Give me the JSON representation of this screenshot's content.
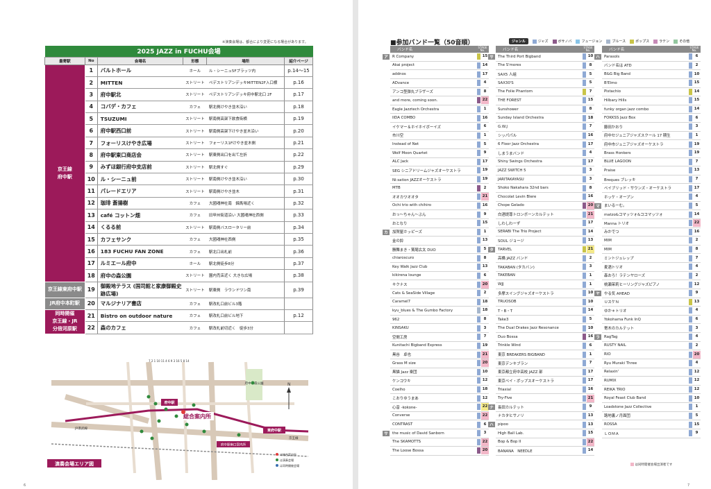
{
  "left_page": {
    "note": "※演奏会場は、都合により変更になる場合があります。",
    "title": "2025 JAZZ in FUCHU会場",
    "headers": [
      "最寄駅",
      "No",
      "会場名",
      "形態",
      "場所",
      "紹介ページ"
    ],
    "stations": [
      {
        "label": "京王線\n府中駅",
        "rows": 18
      },
      {
        "label": "京王線東府中駅",
        "rows": 1
      },
      {
        "label": "JR府中本町駅",
        "rows": 1
      },
      {
        "label": "同時開催\n京王線・JR\n分倍河原駅",
        "rows": 3
      }
    ],
    "venues": [
      {
        "no": "1",
        "name": "バルトホール",
        "form": "ホール",
        "place": "ル・シーニュ5Fプラッツ内",
        "page": "p.14～15"
      },
      {
        "no": "2",
        "name": "MITTEN",
        "form": "ストリート",
        "place": "ペデストリアンデッキMITTEN2F入口横",
        "page": "p.16"
      },
      {
        "no": "3",
        "name": "府中駅北",
        "form": "ストリート",
        "place": "ペデストリアンデッキ府中駅北口 2F",
        "page": "p.17"
      },
      {
        "no": "4",
        "name": "コバデ・カフェ",
        "form": "カフェ",
        "place": "駅北側けやき並木沿い",
        "page": "p.18"
      },
      {
        "no": "5",
        "name": "TSUZUMI",
        "form": "ストリート",
        "place": "駅南側高架下飲食街横",
        "page": "p.19"
      },
      {
        "no": "6",
        "name": "府中駅西口前",
        "form": "ストリート",
        "place": "駅南側高架下けやき並木沿い",
        "page": "p.20"
      },
      {
        "no": "7",
        "name": "フォーリスけやき広場",
        "form": "ストリート",
        "place": "フォーリス1Fけやき並木側",
        "page": "p.21"
      },
      {
        "no": "8",
        "name": "府中駅東口商店会",
        "form": "ストリート",
        "place": "駅東側出口を出て左折",
        "page": "p.22"
      },
      {
        "no": "9",
        "name": "みずほ銀行府中支店前",
        "form": "ストリート",
        "place": "駅北側すぐ",
        "page": "p.29"
      },
      {
        "no": "10",
        "name": "ル・シーニュ前",
        "form": "ストリート",
        "place": "駅南側けやき並木沿い",
        "page": "p.30"
      },
      {
        "no": "11",
        "name": "パレードエリア",
        "form": "ストリート",
        "place": "駅南側けやき並木",
        "page": "p.31"
      },
      {
        "no": "12",
        "name": "珈琲 蒼揚樹",
        "form": "カフェ",
        "place": "大國魂神社南　錦馬場近く",
        "page": "p.32"
      },
      {
        "no": "13",
        "name": "café コットン畑",
        "form": "カフェ",
        "place": "旧甲州街道沿い 大國魂神社西側",
        "page": "p.33"
      },
      {
        "no": "14",
        "name": "くるる前",
        "form": "ストリート",
        "place": "駅南側バスロータリー前",
        "page": "p.34"
      },
      {
        "no": "15",
        "name": "カフェサンク",
        "form": "カフェ",
        "place": "大國魂神社西側",
        "page": "p.35"
      },
      {
        "no": "16",
        "name": "183 FUCHU FAN ZONE",
        "form": "カフェ",
        "place": "駅北口出札前",
        "page": "p.36"
      },
      {
        "no": "17",
        "name": "ルミエール府中",
        "form": "ホール",
        "place": "駅北側徒歩8分",
        "page": "p.37"
      },
      {
        "no": "18",
        "name": "府中の森公園",
        "form": "ストリート",
        "place": "園内売店近く 大きな広場",
        "page": "p.38"
      },
      {
        "no": "19",
        "name": "御殿地テラス (国司館と家康御殿史跡広場)",
        "form": "ストリート",
        "place": "駅東側　ラウンドワン南",
        "page": "p.39"
      },
      {
        "no": "20",
        "name": "マルジナリア書店",
        "form": "カフェ",
        "place": "駅改札口前ビル3階",
        "page": ""
      },
      {
        "no": "21",
        "name": "Bistro on outdoor nature",
        "form": "カフェ",
        "place": "駅改札口前ビル地下",
        "page": "p.12"
      },
      {
        "no": "22",
        "name": "森のカフェ",
        "form": "カフェ",
        "place": "駅改札前切近く　徒歩3分",
        "page": ""
      }
    ],
    "map": {
      "title": "演奏会場エリア図",
      "info_center": "総合案内所",
      "fuchu_station": "府中駅",
      "higashi_station": "東府中駅",
      "keio_line": "京王線",
      "jr_line": "JR南武線",
      "sub_center": "府中駅南口案内所",
      "park": "府中の森公園",
      "legend": [
        "は総合案内所",
        "は演奏会場",
        "は同時開催会場"
      ],
      "north": "N"
    },
    "page_number": "6"
  },
  "right_page": {
    "title": "■参加バンド一覧（50音順）",
    "legend_label": "ジャンル",
    "genres": [
      {
        "name": "ジャズ",
        "color": "#8fa9d4"
      },
      {
        "name": "ボサノバ",
        "color": "#8c5a8a"
      },
      {
        "name": "フュージョン",
        "color": "#88c4e8"
      },
      {
        "name": "ブルース",
        "color": "#a7b7cc"
      },
      {
        "name": "ポップス",
        "color": "#c9c448"
      },
      {
        "name": "ラテン",
        "color": "#c78bb8"
      },
      {
        "name": "その他",
        "color": "#94c7a0"
      }
    ],
    "col_header": {
      "name": "バンド名",
      "stage": "STAGE No."
    },
    "columns": [
      [
        {
          "kana": "ア",
          "name": "R Company",
          "g": "#c9c448",
          "no": "15"
        },
        {
          "name": "Akai project",
          "g": "#8fa9d4",
          "no": "14"
        },
        {
          "name": "addnos",
          "g": "#8fa9d4",
          "no": "17"
        },
        {
          "name": "ADvance",
          "g": "#8fa9d4",
          "no": "4"
        },
        {
          "name": "アンコ型弾丸ブラザーズ",
          "g": "#8fa9d4",
          "no": "8"
        },
        {
          "name": "and more, coming soon.",
          "g": "#8c5a8a",
          "no": "22",
          "hl": "pink"
        },
        {
          "name": "Eagle Jazztech Orchestra",
          "g": "#8fa9d4",
          "no": "1"
        },
        {
          "name": "IIDA COMBO",
          "g": "#8fa9d4",
          "no": "16"
        },
        {
          "name": "イケマー＆ホイホイボーイズ",
          "g": "#8fa9d4",
          "no": "6"
        },
        {
          "name": "市川空",
          "g": "#8fa9d4",
          "no": "1"
        },
        {
          "name": "Instead of Net",
          "g": "#8fa9d4",
          "no": "5"
        },
        {
          "name": "Wolf Moon Quartet",
          "g": "#8fa9d4",
          "no": "9"
        },
        {
          "name": "ALC Jack",
          "g": "#8fa9d4",
          "no": "17"
        },
        {
          "name": "SEG シニアドリームジャズオーケストラ",
          "g": "#8fa9d4",
          "no": "19"
        },
        {
          "name": "Ni:sation JAZZオーケストラ",
          "g": "#8fa9d4",
          "no": "19"
        },
        {
          "name": "MTB",
          "g": "#8c5a8a",
          "no": "2"
        },
        {
          "name": "オオカワオオタ",
          "g": "#8fa9d4",
          "no": "21",
          "hl": "pink"
        },
        {
          "name": "Ochi trio with chihiro",
          "g": "#8fa9d4",
          "no": "16"
        },
        {
          "name": "おっ～ちゃん～ぶん",
          "g": "#8fa9d4",
          "no": "9"
        },
        {
          "name": "おとなり",
          "g": "#8fa9d4",
          "no": "15"
        },
        {
          "kana": "カ",
          "name": "加賀屋ホッピーズ",
          "g": "#8fa9d4",
          "no": "1"
        },
        {
          "name": "金の鈴",
          "g": "#8fa9d4",
          "no": "13"
        },
        {
          "name": "勝舞まき・鷲尾広太 DUO",
          "g": "#8fa9d4",
          "no": "5"
        },
        {
          "name": "chiaroscuro",
          "g": "#8fa9d4",
          "no": "8"
        },
        {
          "name": "Key Walk Jazz Club",
          "g": "#8fa9d4",
          "no": "13"
        },
        {
          "name": "kikirena lounge",
          "g": "#8fa9d4",
          "no": "6"
        },
        {
          "name": "キクナス",
          "g": "#8fa9d4",
          "no": "20",
          "hl": "pink"
        },
        {
          "name": "Cats & SeaSide Village",
          "g": "#8fa9d4",
          "no": "2"
        },
        {
          "name": "Caramel7",
          "g": "#8fa9d4",
          "no": "18"
        },
        {
          "name": "kyu_blues & The Gumbo Factory",
          "g": "#a7b7cc",
          "no": "18"
        },
        {
          "name": "962",
          "g": "#8fa9d4",
          "no": "8"
        },
        {
          "name": "KINSAKU",
          "g": "#8fa9d4",
          "no": "3"
        },
        {
          "name": "空間工房",
          "g": "#8fa9d4",
          "no": "7"
        },
        {
          "name": "Kunitachi Bigband Express",
          "g": "#8fa9d4",
          "no": "19"
        },
        {
          "name": "黒谷　卓也",
          "g": "#8fa9d4",
          "no": "21",
          "hl": "pink"
        },
        {
          "name": "Grass M size",
          "g": "#8fa9d4",
          "no": "20",
          "hl": "pink"
        },
        {
          "name": "黒猫 Jazz 楽団",
          "g": "#8fa9d4",
          "no": "10"
        },
        {
          "name": "ケンコウキ",
          "g": "#8fa9d4",
          "no": "12"
        },
        {
          "name": "Coelho",
          "g": "#8fa9d4",
          "no": "18"
        },
        {
          "name": "こおりゆうまあ",
          "g": "#8fa9d4",
          "no": "12"
        },
        {
          "name": "心音 -kokone-",
          "g": "#8fa9d4",
          "no": "22",
          "hl": "yel"
        },
        {
          "name": "Converse",
          "g": "#8fa9d4",
          "no": "22",
          "hl": "pink"
        },
        {
          "name": "CONTRAST",
          "g": "#8fa9d4",
          "no": "6"
        },
        {
          "kana": "サ",
          "name": "the music of David Sanborn",
          "g": "#8fa9d4",
          "no": "3"
        },
        {
          "name": "The SKAMOTTS",
          "g": "#8fa9d4",
          "no": "22",
          "hl": "pink"
        },
        {
          "name": "The Loose Bossa",
          "g": "#8c5a8a",
          "no": "20",
          "hl": "pink"
        }
      ],
      [
        {
          "kana": "サ",
          "name": "The Third Port Bigband",
          "g": "#8fa9d4",
          "no": "10"
        },
        {
          "name": "The S'mores",
          "g": "#8fa9d4",
          "no": "8"
        },
        {
          "name": "SAX5 人組",
          "g": "#8fa9d4",
          "no": "5"
        },
        {
          "name": "SAX30'S",
          "g": "#8fa9d4",
          "no": "5"
        },
        {
          "name": "The Folie Phantom",
          "g": "#c9c448",
          "no": "7"
        },
        {
          "name": "THE FOREST",
          "g": "#8fa9d4",
          "no": "15"
        },
        {
          "name": "Sunshower",
          "g": "#8fa9d4",
          "no": "8"
        },
        {
          "name": "Sunday Island Orchestra",
          "g": "#8fa9d4",
          "no": "18"
        },
        {
          "name": "G.W.J",
          "g": "#8fa9d4",
          "no": "7"
        },
        {
          "name": "シッパパル",
          "g": "#8fa9d4",
          "no": "16"
        },
        {
          "name": "6 Floor Jazz Orchestra",
          "g": "#8fa9d4",
          "no": "17"
        },
        {
          "name": "しまうまバンド",
          "g": "#8fa9d4",
          "no": "4"
        },
        {
          "name": "Shiny Swings Orchestra",
          "g": "#8fa9d4",
          "no": "17"
        },
        {
          "name": "JAZZ SWITCH 5",
          "g": "#8fa9d4",
          "no": "3"
        },
        {
          "name": "JARITAKAYASU",
          "g": "#8fa9d4",
          "no": "3"
        },
        {
          "name": "Shoko Nakahara 32nd bars",
          "g": "#8fa9d4",
          "no": "8"
        },
        {
          "name": "Chocolat Levin Blere",
          "g": "#8fa9d4",
          "no": "16"
        },
        {
          "name": "Chope Gelado",
          "g": "#8c5a8a",
          "no": "20",
          "hl": "pink"
        },
        {
          "name": "白酒堤尊トロンボーンカルテット",
          "g": "#8fa9d4",
          "no": "21",
          "hl": "pink"
        },
        {
          "name": "しわしわーず",
          "g": "#8fa9d4",
          "no": "17"
        },
        {
          "name": "SERABI The Trio Project",
          "g": "#8fa9d4",
          "no": "14"
        },
        {
          "name": "SOUL ジョージ",
          "g": "#8fa9d4",
          "no": "13"
        },
        {
          "kana": "タ",
          "name": "TARVEL",
          "g": "#c9c448",
          "no": "21",
          "hl": "yel"
        },
        {
          "name": "高橋 JAZZ バンド",
          "g": "#8fa9d4",
          "no": "2"
        },
        {
          "name": "TAKABAN (タカバン)",
          "g": "#8fa9d4",
          "no": "3"
        },
        {
          "name": "TAKEBAN",
          "g": "#8fa9d4",
          "no": "1"
        },
        {
          "name": "WJJ",
          "g": "#8fa9d4",
          "no": "1"
        },
        {
          "name": "多摩スイングジャズオーケストラ",
          "g": "#8fa9d4",
          "no": "10"
        },
        {
          "name": "TRUOSOB",
          "g": "#8fa9d4",
          "no": "10"
        },
        {
          "name": "T・B・T",
          "g": "#8fa9d4",
          "no": "14"
        },
        {
          "name": "Take3",
          "g": "#8fa9d4",
          "no": "5"
        },
        {
          "name": "The Dual Drakes Jazz Resonance",
          "g": "#8fa9d4",
          "no": "10"
        },
        {
          "name": "Duo Bossa",
          "g": "#8c5a8a",
          "no": "16"
        },
        {
          "name": "Trinkle Wind",
          "g": "#8fa9d4",
          "no": "6"
        },
        {
          "name": "東京 BREAKERS BIGBAND",
          "g": "#8fa9d4",
          "no": "1"
        },
        {
          "name": "東京デンキブラン",
          "g": "#8fa9d4",
          "no": "7"
        },
        {
          "name": "東京都立府中高校 JAZZ 部",
          "g": "#8fa9d4",
          "no": "17"
        },
        {
          "name": "東京ベイ・ポップスオーケストラ",
          "g": "#8fa9d4",
          "no": "17"
        },
        {
          "name": "Triaxial",
          "g": "#8fa9d4",
          "no": "16"
        },
        {
          "name": "Try-Five",
          "g": "#8fa9d4",
          "no": "21",
          "hl": "pink"
        },
        {
          "kana": "ナ",
          "name": "長田カルテット",
          "g": "#8fa9d4",
          "no": "9"
        },
        {
          "name": "ナカタヒサノリ",
          "g": "#8fa9d4",
          "no": "13"
        },
        {
          "kana": "ハ",
          "name": "pipoo",
          "g": "#8fa9d4",
          "no": "13"
        },
        {
          "name": "High Ball Lab.",
          "g": "#8fa9d4",
          "no": "15"
        },
        {
          "name": "Bop & Bop II",
          "g": "#8fa9d4",
          "no": "22",
          "hl": "pink"
        },
        {
          "name": "BANANA　NEEDLE",
          "g": "#8fa9d4",
          "no": "14"
        }
      ],
      [
        {
          "kana": "ハ",
          "name": "Parasols",
          "g": "#8fa9d4",
          "no": "6"
        },
        {
          "name": "バンド名は ATD",
          "g": "#8fa9d4",
          "no": "2"
        },
        {
          "name": "B&G Big Band",
          "g": "#8fa9d4",
          "no": "10"
        },
        {
          "name": "B'Elmo",
          "g": "#8fa9d4",
          "no": "15"
        },
        {
          "name": "Pistachio",
          "g": "#c9c448",
          "no": "14"
        },
        {
          "name": "Hilbary Hills",
          "g": "#8fa9d4",
          "no": "15"
        },
        {
          "name": "funky organ jazz combo",
          "g": "#8fa9d4",
          "no": "14"
        },
        {
          "name": "FOKKSS Jazz Box",
          "g": "#8fa9d4",
          "no": "6"
        },
        {
          "name": "藤田かおり",
          "g": "#8fa9d4",
          "no": "3"
        },
        {
          "name": "府中セジュニアジャズスクール 17 期生",
          "g": "#8fa9d4",
          "no": "1"
        },
        {
          "name": "府中市ジュニアジャズオーケストラ",
          "g": "#8fa9d4",
          "no": "19"
        },
        {
          "name": "Brass Honkers",
          "g": "#8fa9d4",
          "no": "19"
        },
        {
          "name": "BLUE LAGOON",
          "g": "#8fa9d4",
          "no": "7"
        },
        {
          "name": "Praise",
          "g": "#8fa9d4",
          "no": "13"
        },
        {
          "name": "Breques ブレッキ",
          "g": "#8fa9d4",
          "no": "7"
        },
        {
          "name": "ベイブリッド・サウンズ・オーケストラ",
          "g": "#8fa9d4",
          "no": "17"
        },
        {
          "name": "ホッケ・オープン",
          "g": "#8fa9d4",
          "no": "4"
        },
        {
          "kana": "マ",
          "name": "まいるーむ。",
          "g": "#8fa9d4",
          "no": "5"
        },
        {
          "name": "matzo&コマッツォ&ココマッツォ",
          "g": "#8fa9d4",
          "no": "14"
        },
        {
          "name": "Manna トリオ",
          "g": "#8fa9d4",
          "no": "22",
          "hl": "pink"
        },
        {
          "name": "みかでつ",
          "g": "#8fa9d4",
          "no": "16"
        },
        {
          "name": "MIM",
          "g": "#8fa9d4",
          "no": "2"
        },
        {
          "name": "MIM",
          "g": "#8fa9d4",
          "no": "8"
        },
        {
          "name": "ミントジュレップ",
          "g": "#8fa9d4",
          "no": "7"
        },
        {
          "name": "麦酒トリオ",
          "g": "#8fa9d4",
          "no": "4"
        },
        {
          "name": "森おろ！ラテンヤローズ",
          "g": "#8fa9d4",
          "no": "2"
        },
        {
          "name": "桃瀬茉莉ヒーリングジャズピアノ",
          "g": "#8fa9d4",
          "no": "12"
        },
        {
          "kana": "ヤ",
          "name": "やる気 AHEAD",
          "g": "#8fa9d4",
          "no": "9"
        },
        {
          "name": "ＵスケＮ",
          "g": "#c9c448",
          "no": "13"
        },
        {
          "name": "ゆか＊トリオ",
          "g": "#8fa9d4",
          "no": "4"
        },
        {
          "name": "Yokohama Funk InQ",
          "g": "#8fa9d4",
          "no": "6"
        },
        {
          "name": "寄木のカルテット",
          "g": "#8fa9d4",
          "no": "3"
        },
        {
          "kana": "ラ",
          "name": "RagTag",
          "g": "#8fa9d4",
          "no": "4"
        },
        {
          "name": "RUSTY NAIL",
          "g": "#8fa9d4",
          "no": "2"
        },
        {
          "name": "RIO",
          "g": "#8fa9d4",
          "no": "20",
          "hl": "pink"
        },
        {
          "name": "Ryu Muraki Three",
          "g": "#8fa9d4",
          "no": "4"
        },
        {
          "name": "Relaxin'",
          "g": "#8fa9d4",
          "no": "12"
        },
        {
          "name": "RUMIX",
          "g": "#8fa9d4",
          "no": "12"
        },
        {
          "name": "REIKA TRIO",
          "g": "#8fa9d4",
          "no": "12"
        },
        {
          "name": "Royal Feast Club Band",
          "g": "#8fa9d4",
          "no": "10"
        },
        {
          "name": "Loadstone Jazz Collective",
          "g": "#8fa9d4",
          "no": "1"
        },
        {
          "name": "路地裏ノ月面団",
          "g": "#8fa9d4",
          "no": "5"
        },
        {
          "name": "ROSSA",
          "g": "#8fa9d4",
          "no": "15"
        },
        {
          "name": "ＬＯＭＡ",
          "g": "#8fa9d4",
          "no": "9"
        }
      ]
    ],
    "footnote": "は同時開催会場出演者です",
    "page_number": "7"
  }
}
